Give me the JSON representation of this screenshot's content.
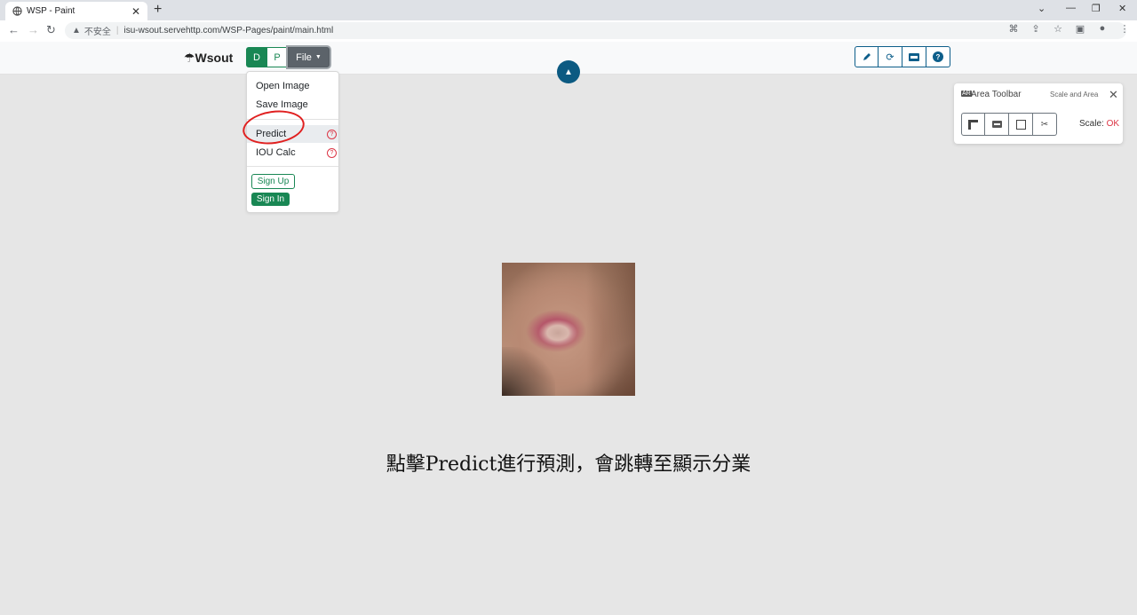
{
  "browser": {
    "tab_title": "WSP - Paint",
    "tab_close": "✕",
    "new_tab": "+",
    "insecure_label": "不安全",
    "url": "isu-wsout.servehttp.com/WSP-Pages/paint/main.html",
    "window_controls": [
      "⌄",
      "—",
      "❐",
      "✕"
    ]
  },
  "app": {
    "brand": "☂Wsout",
    "modes": {
      "d": "D",
      "p": "P"
    },
    "file_menu_label": "File",
    "collapse_icon": "▲"
  },
  "file_menu": {
    "open_image": "Open Image",
    "save_image": "Save Image",
    "predict": "Predict",
    "iou_calc": "IOU Calc",
    "help_mark": "?",
    "sign_up": "Sign Up",
    "sign_in": "Sign In"
  },
  "area_toolbar": {
    "title": "Area Toolbar",
    "subtitle": "Scale and Area",
    "close": "✕",
    "scale_label": "Scale:",
    "scale_value": "OK",
    "tools": [
      "ruler",
      "area",
      "square",
      "cut"
    ]
  },
  "caption": "點擊Predict進行預測，會跳轉至顯示分業",
  "colors": {
    "primary_green": "#198754",
    "dark_blue": "#0c5a82",
    "annotation_red": "#e02020",
    "danger": "#dc3545"
  }
}
